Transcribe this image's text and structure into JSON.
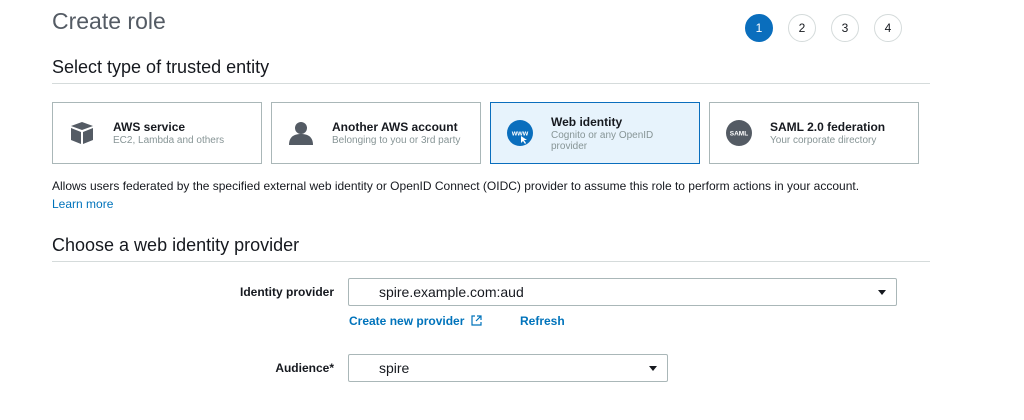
{
  "page": {
    "title": "Create role"
  },
  "wizard": {
    "steps": [
      "1",
      "2",
      "3",
      "4"
    ],
    "current_step": "1"
  },
  "trusted_entity": {
    "heading": "Select type of trusted entity",
    "cards": [
      {
        "title": "AWS service",
        "subtitle": [
          "EC2, Lambda and others"
        ],
        "icon": "cube-icon",
        "selected": false
      },
      {
        "title": "Another AWS account",
        "subtitle": [
          "Belonging to you or 3rd party"
        ],
        "icon": "person-icon",
        "selected": false
      },
      {
        "title": "Web identity",
        "subtitle": [
          "Cognito or any OpenID",
          "provider"
        ],
        "icon": "www-globe-icon",
        "icon_text": "www",
        "selected": true
      },
      {
        "title": "SAML 2.0 federation",
        "subtitle": [
          "Your corporate directory"
        ],
        "icon": "saml-icon",
        "icon_text": "SAML",
        "selected": false
      }
    ],
    "description": "Allows users federated by the specified external web identity or OpenID Connect (OIDC) provider to assume this role to perform actions in your account.",
    "learn_more": "Learn more"
  },
  "provider_section": {
    "heading": "Choose a web identity provider",
    "identity_provider": {
      "label": "Identity provider",
      "value": "spire.example.com:aud"
    },
    "create_provider_link": "Create new provider",
    "refresh_link": "Refresh",
    "audience": {
      "label": "Audience*",
      "value": "spire"
    }
  },
  "colors": {
    "accent": "#0a6ebd",
    "link": "#0073bb",
    "selected_bg": "#e7f3fc",
    "border": "#aab7b8"
  }
}
